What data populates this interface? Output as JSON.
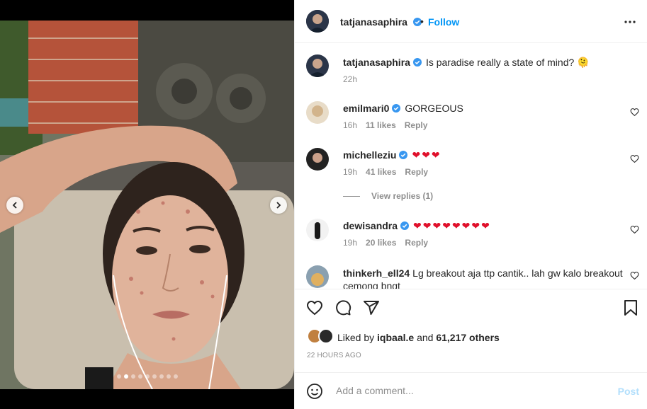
{
  "post": {
    "author": "tatjanasaphira",
    "follow_label": "Follow",
    "separator": "•",
    "caption": "Is paradise really a state of mind? 🫠",
    "caption_time": "22h"
  },
  "carousel": {
    "slide_count": 9,
    "active_index": 1
  },
  "comments": [
    {
      "user": "emilmari0",
      "verified": true,
      "text": "GORGEOUS",
      "time": "16h",
      "likes": "11 likes",
      "reply": "Reply"
    },
    {
      "user": "michelleziu",
      "verified": true,
      "text": "❤❤❤",
      "time": "19h",
      "likes": "41 likes",
      "reply": "Reply",
      "view_replies": "View replies (1)"
    },
    {
      "user": "dewisandra",
      "verified": true,
      "text": "❤❤❤❤❤❤❤❤",
      "time": "19h",
      "likes": "20 likes",
      "reply": "Reply"
    },
    {
      "user": "thinkerh_ell24",
      "verified": false,
      "text": "Lg breakout aja ttp cantik.. lah gw kalo breakout",
      "text2": "cemong bngt"
    }
  ],
  "likes": {
    "prefix": "Liked by",
    "user": "iqbaal.e",
    "mid": "and",
    "count": "61,217 others"
  },
  "timestamp": "22 HOURS AGO",
  "add_comment": {
    "placeholder": "Add a comment...",
    "post_label": "Post"
  },
  "colors": {
    "link": "#0095f6",
    "verified": "#3897f0",
    "heart_emoji": "#e0102b",
    "post_disabled": "#b2dffc"
  },
  "icons": [
    "more-icon",
    "heart-icon",
    "comment-icon",
    "share-icon",
    "bookmark-icon",
    "emoji-icon",
    "chevron-left-icon",
    "chevron-right-icon",
    "verified-icon"
  ]
}
